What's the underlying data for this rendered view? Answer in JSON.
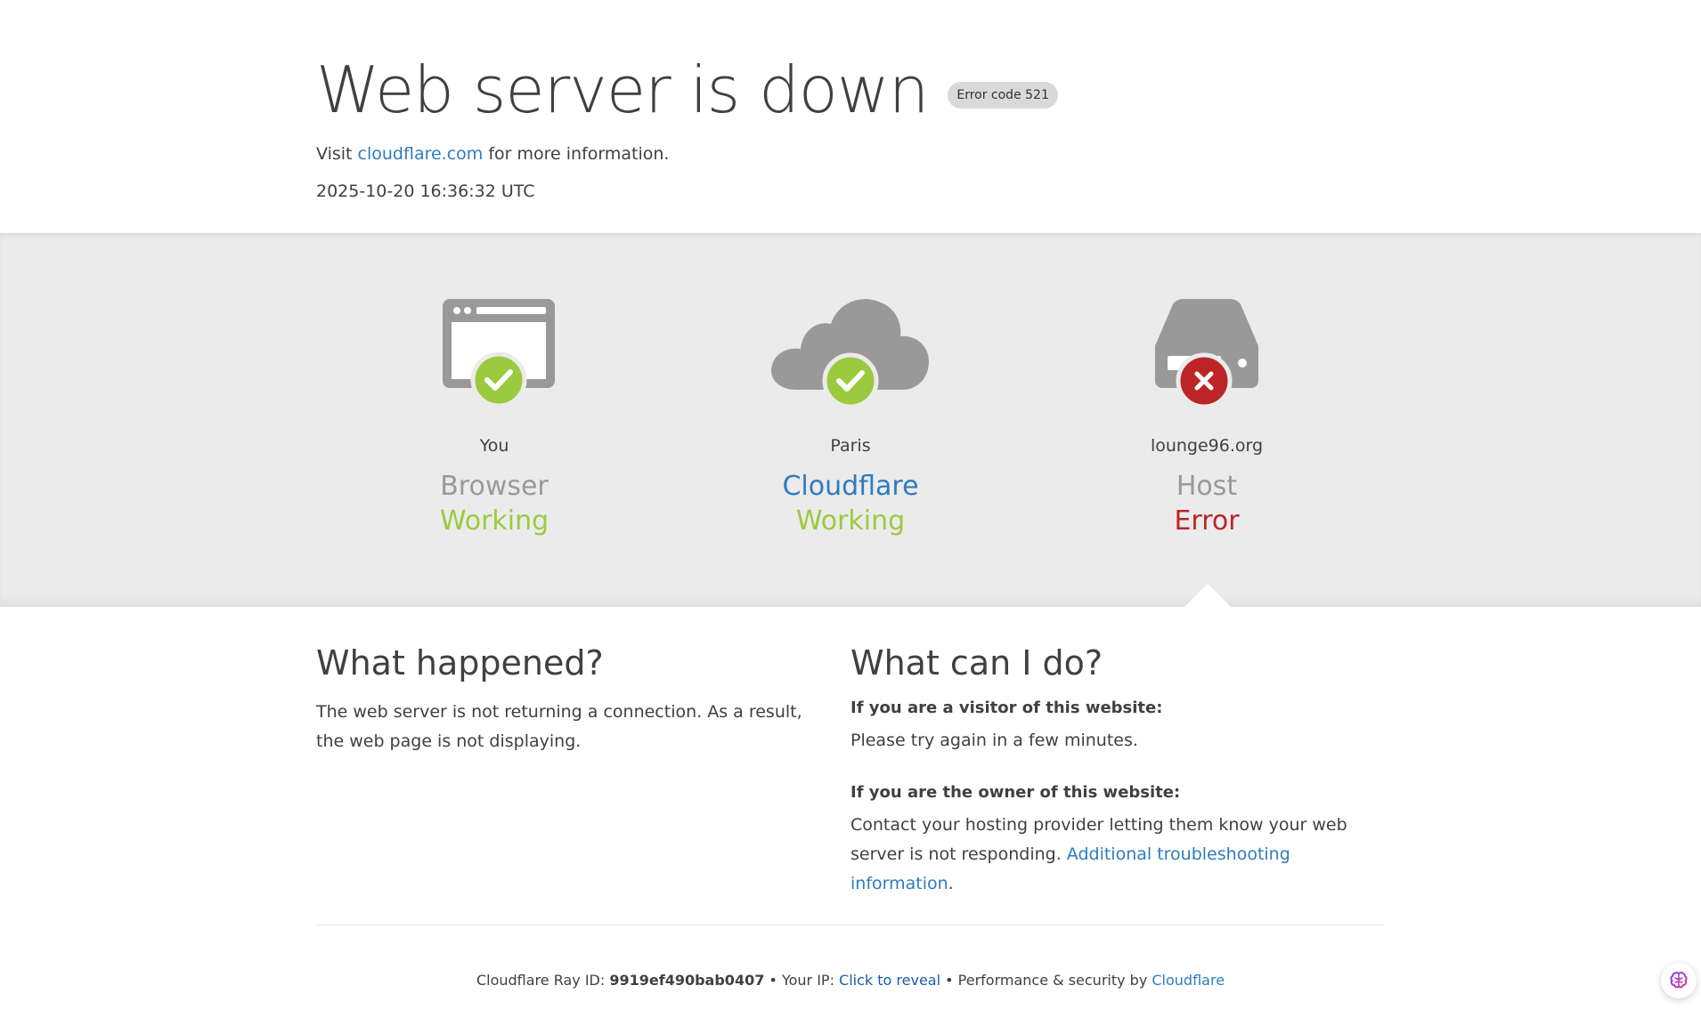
{
  "header": {
    "title": "Web server is down",
    "error_badge": "Error code 521",
    "visit_prefix": "Visit ",
    "visit_link": "cloudflare.com",
    "visit_suffix": " for more information.",
    "timestamp": "2025-10-20 16:36:32 UTC"
  },
  "status": [
    {
      "location": "You",
      "role": "Browser",
      "state": "Working",
      "icon": "browser-icon",
      "badge": "check-icon"
    },
    {
      "location": "Paris",
      "role": "Cloudflare",
      "state": "Working",
      "icon": "cloud-icon",
      "badge": "check-icon"
    },
    {
      "location": "lounge96.org",
      "role": "Host",
      "state": "Error",
      "icon": "server-icon",
      "badge": "x-icon"
    }
  ],
  "what_happened": {
    "heading": "What happened?",
    "text": "The web server is not returning a connection. As a result, the web page is not displaying."
  },
  "what_can_i_do": {
    "heading": "What can I do?",
    "visitor_heading": "If you are a visitor of this website:",
    "visitor_text": "Please try again in a few minutes.",
    "owner_heading": "If you are the owner of this website:",
    "owner_text": "Contact your hosting provider letting them know your web server is not responding. ",
    "owner_link": "Additional troubleshooting information",
    "owner_suffix": "."
  },
  "footer": {
    "ray_label": "Cloudflare Ray ID: ",
    "ray_id": "9919ef490bab0407",
    "sep1": " • ",
    "ip_label": "Your IP: ",
    "ip_link": "Click to reveal",
    "sep2": " • ",
    "perf_label": "Performance & security by ",
    "perf_link": "Cloudflare"
  },
  "colors": {
    "ok": "#9bca3e",
    "error": "#bd2426",
    "link": "#2f7bbf",
    "band": "#ebebeb",
    "icon_gray": "#999999"
  }
}
